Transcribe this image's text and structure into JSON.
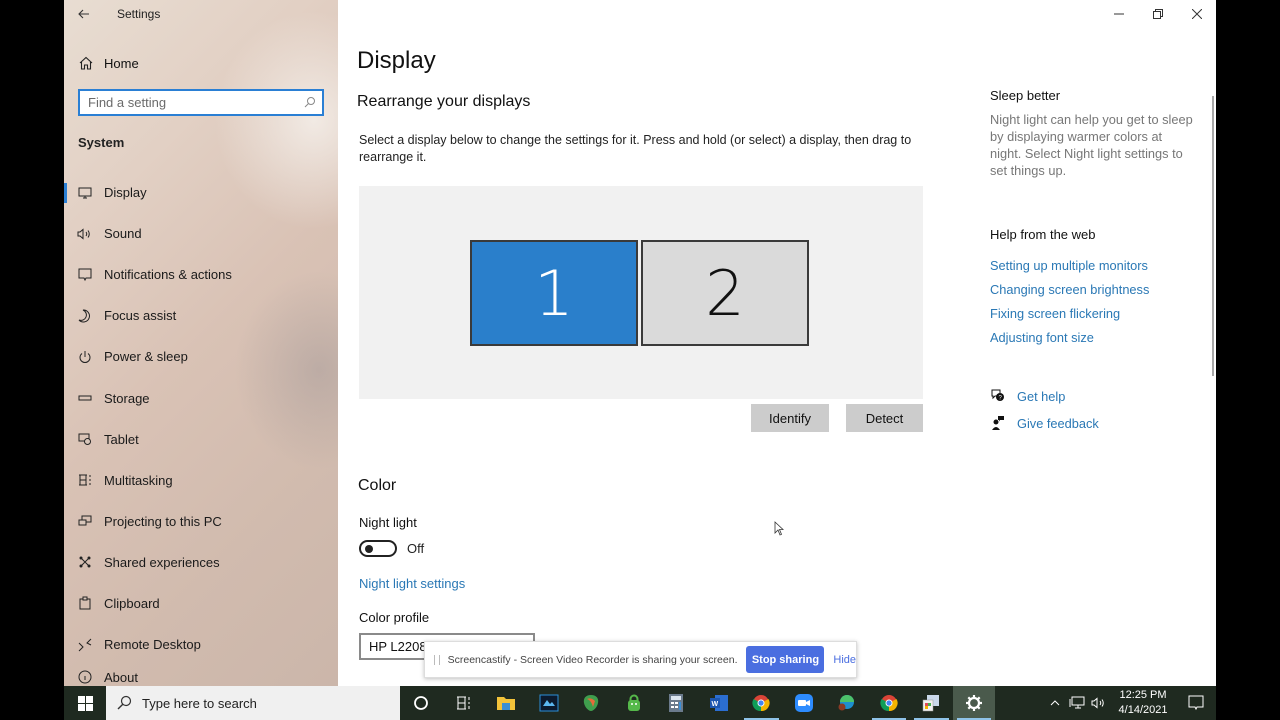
{
  "window": {
    "title": "Settings",
    "back_icon": "back-arrow-icon",
    "controls": [
      "minimize",
      "restore",
      "close"
    ]
  },
  "sidebar": {
    "home_label": "Home",
    "search_placeholder": "Find a setting",
    "section": "System",
    "items": [
      {
        "label": "Display",
        "icon": "display-icon",
        "active": true
      },
      {
        "label": "Sound",
        "icon": "sound-icon"
      },
      {
        "label": "Notifications & actions",
        "icon": "notifications-icon"
      },
      {
        "label": "Focus assist",
        "icon": "moon-icon"
      },
      {
        "label": "Power & sleep",
        "icon": "power-icon"
      },
      {
        "label": "Storage",
        "icon": "storage-icon"
      },
      {
        "label": "Tablet",
        "icon": "tablet-icon"
      },
      {
        "label": "Multitasking",
        "icon": "multitasking-icon"
      },
      {
        "label": "Projecting to this PC",
        "icon": "projecting-icon"
      },
      {
        "label": "Shared experiences",
        "icon": "shared-experiences-icon"
      },
      {
        "label": "Clipboard",
        "icon": "clipboard-icon"
      },
      {
        "label": "Remote Desktop",
        "icon": "remote-desktop-icon"
      },
      {
        "label": "About",
        "icon": "info-icon"
      }
    ]
  },
  "main": {
    "title": "Display",
    "rearrange": {
      "heading": "Rearrange your displays",
      "description": "Select a display below to change the settings for it. Press and hold (or select) a display, then drag to rearrange it.",
      "monitors": [
        {
          "label": "1",
          "selected": true
        },
        {
          "label": "2",
          "selected": false
        }
      ],
      "identify_label": "Identify",
      "detect_label": "Detect"
    },
    "color": {
      "heading": "Color",
      "night_light_label": "Night light",
      "night_light_state": "Off",
      "night_light_on": false,
      "night_light_settings_link": "Night light settings",
      "color_profile_label": "Color profile",
      "color_profile_value": "HP L2208w LCD Monitor"
    }
  },
  "aside": {
    "sleep_heading": "Sleep better",
    "sleep_text": "Night light can help you get to sleep by displaying warmer colors at night. Select Night light settings to set things up.",
    "help_heading": "Help from the web",
    "help_links": [
      "Setting up multiple monitors",
      "Changing screen brightness",
      "Fixing screen flickering",
      "Adjusting font size"
    ],
    "get_help": "Get help",
    "give_feedback": "Give feedback"
  },
  "share_bar": {
    "message": "Screencastify - Screen Video Recorder is sharing your screen.",
    "stop_label": "Stop sharing",
    "hide_label": "Hide"
  },
  "taskbar": {
    "search_placeholder": "Type here to search",
    "apps": [
      {
        "name": "cortana",
        "active": false
      },
      {
        "name": "task-view",
        "active": false
      },
      {
        "name": "file-explorer",
        "active": false
      },
      {
        "name": "video-editor",
        "active": false
      },
      {
        "name": "browser-app",
        "active": false
      },
      {
        "name": "vpn-app",
        "active": false
      },
      {
        "name": "calculator",
        "active": false
      },
      {
        "name": "word",
        "active": false
      },
      {
        "name": "chrome",
        "active": true
      },
      {
        "name": "zoom",
        "active": false
      },
      {
        "name": "edge",
        "active": false
      },
      {
        "name": "chrome-profile",
        "active": true
      },
      {
        "name": "photos-app",
        "active": true
      },
      {
        "name": "settings",
        "active": true,
        "selected": true
      }
    ],
    "time": "12:25 PM",
    "date": "4/14/2021"
  },
  "colors": {
    "accent": "#2a7fd4",
    "link": "#2a78b5",
    "monitor_selected": "#2a7fcb",
    "monitor_unselected": "#dadada",
    "stop_button": "#4a6ee0",
    "taskbar": "#1f2a20"
  }
}
